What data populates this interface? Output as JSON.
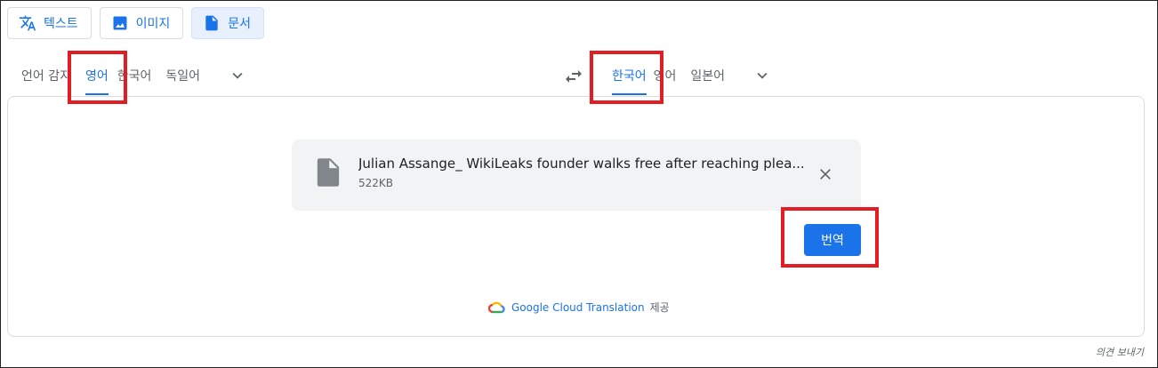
{
  "mode_tabs": [
    {
      "label": "텍스트",
      "icon": "translate-icon"
    },
    {
      "label": "이미지",
      "icon": "image-icon"
    },
    {
      "label": "문서",
      "icon": "document-icon",
      "active": true
    }
  ],
  "source_languages": [
    "언어 감지",
    "영어",
    "한국어",
    "독일어"
  ],
  "source_active": "영어",
  "target_languages": [
    "한국어",
    "영어",
    "일본어"
  ],
  "target_active": "한국어",
  "file": {
    "name": "Julian Assange_ WikiLeaks founder walks free after reaching plea...",
    "size": "522KB"
  },
  "translate_button": "번역",
  "attribution": {
    "brand": "Google Cloud Translation",
    "suffix": "제공"
  },
  "feedback": "의견 보내기",
  "colors": {
    "accent": "#1a73e8",
    "highlight": "#e21d24"
  }
}
